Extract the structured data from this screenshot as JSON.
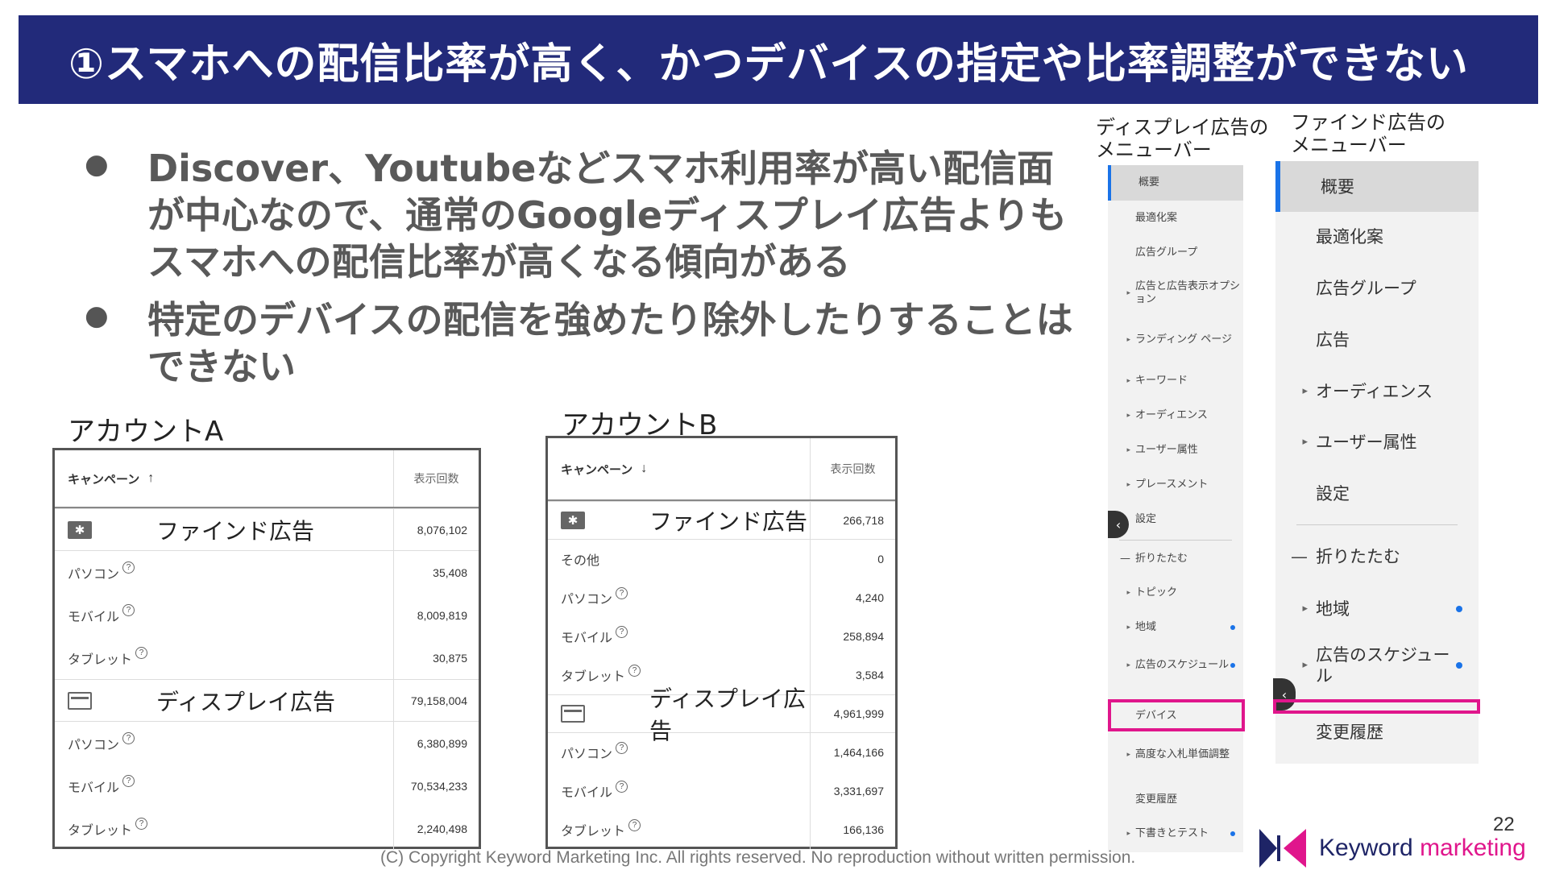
{
  "title": "①スマホへの配信比率が高く、かつデバイスの指定や比率調整ができない",
  "bullets": [
    "Discover、Youtubeなどスマホ利用率が高い配信面が中心なので、通常のGoogleディスプレイ広告よりもスマホへの配信比率が高くなる傾向がある",
    "特定のデバイスの配信を強めたり除外したりすることはできない"
  ],
  "account_a": {
    "label": "アカウントA",
    "header": {
      "campaign": "キャンペーン",
      "sort_arrow": "↑",
      "impressions": "表示回数"
    },
    "rows": [
      {
        "type": "group",
        "icon": "find-ads-icon",
        "name": "ファインド広告",
        "value": "8,076,102"
      },
      {
        "type": "device",
        "name": "パソコン",
        "value": "35,408"
      },
      {
        "type": "device",
        "name": "モバイル",
        "value": "8,009,819"
      },
      {
        "type": "device",
        "name": "タブレット",
        "value": "30,875"
      },
      {
        "type": "group",
        "icon": "display-ads-icon",
        "name": "ディスプレイ広告",
        "value": "79,158,004"
      },
      {
        "type": "device",
        "name": "パソコン",
        "value": "6,380,899"
      },
      {
        "type": "device",
        "name": "モバイル",
        "value": "70,534,233"
      },
      {
        "type": "device",
        "name": "タブレット",
        "value": "2,240,498"
      }
    ]
  },
  "account_b": {
    "label": "アカウントB",
    "header": {
      "campaign": "キャンペーン",
      "sort_arrow": "↓",
      "impressions": "表示回数"
    },
    "rows": [
      {
        "type": "group",
        "icon": "find-ads-icon",
        "name": "ファインド広告",
        "value": "266,718"
      },
      {
        "type": "device",
        "name": "その他",
        "value": "0"
      },
      {
        "type": "device",
        "name": "パソコン",
        "value": "4,240"
      },
      {
        "type": "device",
        "name": "モバイル",
        "value": "258,894"
      },
      {
        "type": "device",
        "name": "タブレット",
        "value": "3,584"
      },
      {
        "type": "group",
        "icon": "display-ads-icon",
        "name": "ディスプレイ広告",
        "value": "4,961,999"
      },
      {
        "type": "device",
        "name": "パソコン",
        "value": "1,464,166"
      },
      {
        "type": "device",
        "name": "モバイル",
        "value": "3,331,697"
      },
      {
        "type": "device",
        "name": "タブレット",
        "value": "166,136"
      }
    ]
  },
  "display_menu": {
    "label_line1": "ディスプレイ広告の",
    "label_line2": "メニューバー",
    "items": [
      {
        "label": "概要",
        "active": true
      },
      {
        "label": "最適化案"
      },
      {
        "label": "広告グループ"
      },
      {
        "label": "広告と広告表示オプション",
        "chevron": true
      },
      {
        "label": "ランディング ページ",
        "chevron": true
      },
      {
        "label": "キーワード",
        "chevron": true
      },
      {
        "label": "オーディエンス",
        "chevron": true
      },
      {
        "label": "ユーザー属性",
        "chevron": true
      },
      {
        "label": "プレースメント",
        "chevron": true
      },
      {
        "label": "設定"
      },
      {
        "label": "折りたたむ",
        "collapse": true
      },
      {
        "label": "トピック",
        "chevron": true
      },
      {
        "label": "地域",
        "chevron": true,
        "dot": true
      },
      {
        "label": "広告のスケジュール",
        "chevron": true,
        "dot": true
      },
      {
        "label": "デバイス",
        "highlight": true
      },
      {
        "label": "高度な入札単価調整",
        "chevron": true
      },
      {
        "label": "変更履歴"
      },
      {
        "label": "下書きとテスト",
        "chevron": true,
        "dot": true
      }
    ]
  },
  "find_menu": {
    "label_line1": "ファインド広告の",
    "label_line2": "メニューバー",
    "items": [
      {
        "label": "概要",
        "active": true
      },
      {
        "label": "最適化案"
      },
      {
        "label": "広告グループ"
      },
      {
        "label": "広告"
      },
      {
        "label": "オーディエンス",
        "chevron": true
      },
      {
        "label": "ユーザー属性",
        "chevron": true
      },
      {
        "label": "設定"
      },
      {
        "label": "折りたたむ",
        "collapse": true
      },
      {
        "label": "地域",
        "chevron": true,
        "dot": true
      },
      {
        "label": "広告のスケジュール",
        "chevron": true,
        "dot": true
      },
      {
        "label": "変更履歴"
      }
    ]
  },
  "footer": "(C) Copyright Keyword Marketing Inc. All rights reserved. No reproduction without written permission.",
  "page_number": "22",
  "logo": {
    "word1": "Keyword",
    "word2": "marketing",
    "accent": "#e0168c",
    "brand": "#1e2466"
  },
  "colors": {
    "title_bg": "#222a7a",
    "highlight": "#e0168c",
    "menu_active": "#1a73e8"
  }
}
